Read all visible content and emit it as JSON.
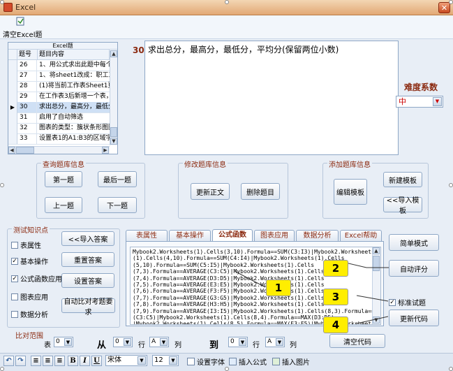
{
  "window": {
    "title": "Excel",
    "close_glyph": "✕"
  },
  "toolbar": {
    "clear_excel_label": "清空Excel题"
  },
  "grid": {
    "caption": "Excel题",
    "col_num": "题号",
    "col_content": "题目内容",
    "rows": [
      {
        "num": "26",
        "text": "1、用公式求出此题中每个"
      },
      {
        "num": "27",
        "text": "1、将sheet1改成：职工工"
      },
      {
        "num": "28",
        "text": "(1)将当前工作表Sheet1更"
      },
      {
        "num": "29",
        "text": "在工作表3后新增一个表，"
      },
      {
        "num": "30",
        "text": "求出总分，最高分，最低分"
      },
      {
        "num": "31",
        "text": "启用了自动筛选"
      },
      {
        "num": "32",
        "text": "图表的类型：簇状条形图图"
      },
      {
        "num": "33",
        "text": "设置表1的A1:B3的区域字体"
      }
    ],
    "selected_marker": "▶"
  },
  "question": {
    "number": "30、",
    "text": "求出总分，最高分，最低分，平均分(保留两位小数)"
  },
  "difficulty": {
    "label": "难度系数",
    "value": "中"
  },
  "query_group": {
    "title": "查询题库信息",
    "first": "第一题",
    "last": "最后一题",
    "prev": "上一题",
    "next": "下一题"
  },
  "modify_group": {
    "title": "修改题库信息",
    "update": "更新正文",
    "delete": "删除题目"
  },
  "add_group": {
    "title": "添加题库信息",
    "new_template": "新建模板",
    "edit_template": "编辑模板",
    "import_template": "<<导入模板"
  },
  "test_group": {
    "title": "测试知识点",
    "checks": [
      {
        "label": "表属性",
        "checked": false
      },
      {
        "label": "基本操作",
        "checked": true
      },
      {
        "label": "公式函数应用",
        "checked": true
      },
      {
        "label": "图表应用",
        "checked": false
      },
      {
        "label": "数据分析",
        "checked": false
      }
    ],
    "import_answer": "<<导入答案",
    "reset_answer": "重置答案",
    "set_answer": "设置答案",
    "auto_compare": "自动比对考题要求"
  },
  "tabs": [
    "表属性",
    "基本操作",
    "公式函数",
    "图表应用",
    "数据分析",
    "Excel帮助"
  ],
  "active_tab": 2,
  "code_lines": [
    "Mybook2.Worksheets(1).Cells(3,10).Formula==SUM(C3:I3)|Mybook2.Worksheets",
    "(1).Cells(4,10).Formula==SUM(C4:I4)|Mybook2.Worksheets(1).Cells",
    "(5,10).Formula==SUM(C5:I5)|Mybook2.Worksheets(1).Cells",
    "(7,3).Formula==AVERAGE(C3:C5)|Mybook2.Worksheets(1).Cells",
    "(7,4).Formula==AVERAGE(D3:D5)|Mybook2.Worksheets(1).Cells",
    "(7,5).Formula==AVERAGE(E3:E5)|Mybook2.Worksheets(1).Cells",
    "(7,6).Formula==AVERAGE(F3:F5)|Mybook2.Worksheets(1).Cells",
    "(7,7).Formula==AVERAGE(G3:G5)|Mybook2.Worksheets(1).Cells",
    "(7,8).Formula==AVERAGE(H3:H5)|Mybook2.Worksheets(1).Cells",
    "(7,9).Formula==AVERAGE(I3:I5)|Mybook2.Worksheets(1).Cells(8,3).Formula==MAX",
    "(C3:C5)|Mybook2.Worksheets(1).Cells(8,4).Formula==MAX(D3:D5)",
    "|Mybook2.Worksheets(1).Cells(8,5).Formula==MAX(E3:E5)|Mybook2.Worksheets"
  ],
  "right_controls": {
    "simple_mode": "简单模式",
    "auto_score": "自动评分",
    "standard_label": "标准试题",
    "standard_checked": true,
    "update_code": "更新代码",
    "clear_code": "清空代码"
  },
  "callouts": [
    "1",
    "2",
    "3",
    "4"
  ],
  "range": {
    "title": "比对范围",
    "table_label": "表",
    "from_label": "从",
    "to_label": "到",
    "row_label": "行",
    "col_label": "列",
    "dd_value_num": "0",
    "dd_value_col": "A"
  },
  "format_bar": {
    "font_name": "宋体",
    "font_size": "12",
    "bold": "B",
    "italic": "I",
    "underline": "U",
    "set_font": "设置字体",
    "insert_formula": "插入公式",
    "insert_image": "插入图片"
  },
  "colors": {
    "title_bar": "#e2a874",
    "label_red": "#8b2a10",
    "callout": "#ffee00"
  }
}
